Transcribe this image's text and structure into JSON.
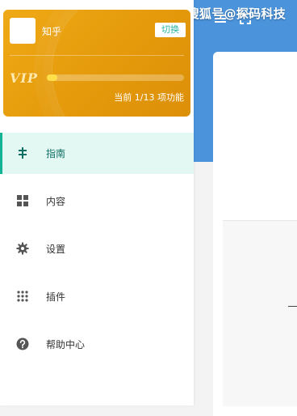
{
  "watermark": "搜狐号@探码科技",
  "vip_card": {
    "name": "知乎",
    "switch_label": "切换",
    "vip_logo": "VIP",
    "progress_text": "当前 1/13 项功能",
    "progress_fraction": 0.0769
  },
  "menu": [
    {
      "label": "指南",
      "icon": "signpost-icon",
      "active": true
    },
    {
      "label": "内容",
      "icon": "grid-icon",
      "active": false
    },
    {
      "label": "设置",
      "icon": "gear-icon",
      "active": false
    },
    {
      "label": "插件",
      "icon": "dots-grid-icon",
      "active": false
    },
    {
      "label": "帮助中心",
      "icon": "help-circle-icon",
      "active": false
    }
  ],
  "toolbar": {
    "icons": [
      "menu-icon",
      "fullscreen-icon"
    ]
  },
  "colors": {
    "accent": "#12b394",
    "vip_gold": "#e49a0b",
    "header_blue": "#4b94dc"
  }
}
